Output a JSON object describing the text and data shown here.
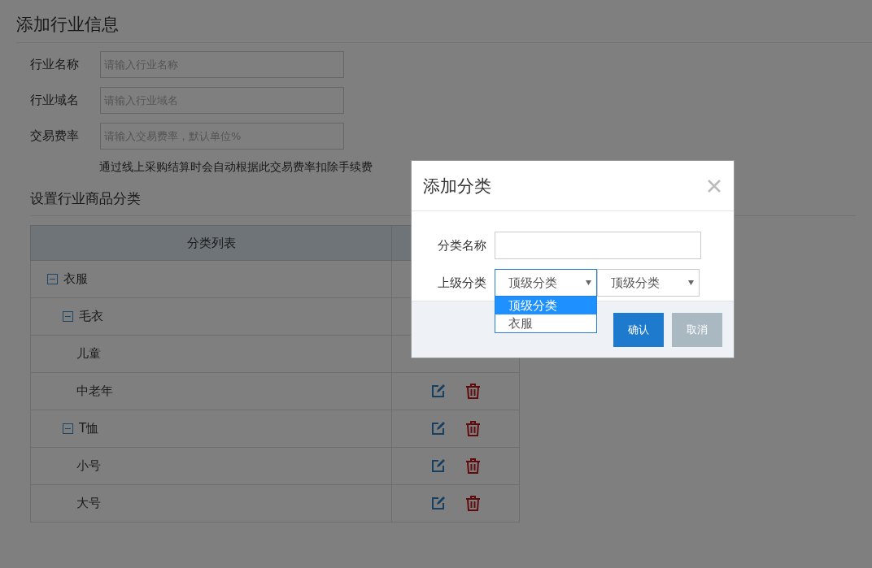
{
  "page": {
    "title": "添加行业信息",
    "fields": [
      {
        "label": "行业名称",
        "placeholder": "请输入行业名称"
      },
      {
        "label": "行业域名",
        "placeholder": "请输入行业域名"
      },
      {
        "label": "交易费率",
        "placeholder": "请输入交易费率，默认单位%"
      }
    ],
    "hint": "通过线上采购结算时会自动根据此交易费率扣除手续费",
    "section_title": "设置行业商品分类",
    "table": {
      "columns": [
        "分类列表"
      ],
      "rows": [
        {
          "label": "衣服",
          "expanded": true,
          "actions": false,
          "children": [
            {
              "label": "毛衣",
              "expanded": true,
              "actions": false,
              "children": [
                {
                  "label": "儿童",
                  "actions": false
                },
                {
                  "label": "中老年",
                  "actions": true
                }
              ]
            },
            {
              "label": "T恤",
              "expanded": true,
              "actions": true,
              "children": [
                {
                  "label": "小号",
                  "actions": true
                },
                {
                  "label": "大号",
                  "actions": true
                }
              ]
            }
          ]
        }
      ]
    }
  },
  "dialog": {
    "title": "添加分类",
    "fields": [
      {
        "kind": "text",
        "label": "分类名称"
      },
      {
        "kind": "select_pair",
        "label": "上级分类",
        "selects": [
          {
            "value": "顶级分类",
            "open": true,
            "options": [
              {
                "label": "顶级分类",
                "selected": true
              },
              {
                "label": "衣服",
                "selected": false
              }
            ]
          },
          {
            "value": "顶级分类",
            "open": false
          }
        ]
      }
    ],
    "buttons": [
      {
        "label": "确认",
        "kind": "primary"
      },
      {
        "label": "取消",
        "kind": "secondary"
      }
    ]
  }
}
